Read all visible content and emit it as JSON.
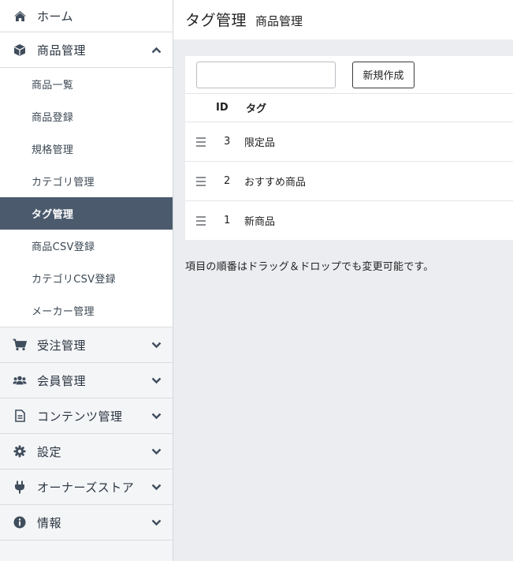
{
  "sidebar": {
    "home": {
      "label": "ホーム",
      "icon": "home-icon"
    },
    "product": {
      "label": "商品管理",
      "icon": "box-icon",
      "expanded": true,
      "items": [
        {
          "label": "商品一覧"
        },
        {
          "label": "商品登録"
        },
        {
          "label": "規格管理"
        },
        {
          "label": "カテゴリ管理"
        },
        {
          "label": "タグ管理",
          "active": true
        },
        {
          "label": "商品CSV登録"
        },
        {
          "label": "カテゴリCSV登録"
        },
        {
          "label": "メーカー管理"
        }
      ]
    },
    "sections": [
      {
        "label": "受注管理",
        "icon": "cart-icon"
      },
      {
        "label": "会員管理",
        "icon": "users-icon"
      },
      {
        "label": "コンテンツ管理",
        "icon": "document-icon"
      },
      {
        "label": "設定",
        "icon": "gear-icon"
      },
      {
        "label": "オーナーズストア",
        "icon": "plug-icon"
      },
      {
        "label": "情報",
        "icon": "info-icon"
      }
    ]
  },
  "header": {
    "title": "タグ管理",
    "subtitle": "商品管理"
  },
  "form": {
    "input_value": "",
    "new_button": "新規作成"
  },
  "table": {
    "columns": [
      "ID",
      "タグ"
    ],
    "rows": [
      {
        "id": "3",
        "tag": "限定品"
      },
      {
        "id": "2",
        "tag": "おすすめ商品"
      },
      {
        "id": "1",
        "tag": "新商品"
      }
    ]
  },
  "hint": "項目の順番はドラッグ＆ドロップでも変更可能です。",
  "colors": {
    "active_bg": "#4b5b6d",
    "sidebar_text": "#2a3541",
    "page_bg": "#ebedf0"
  }
}
